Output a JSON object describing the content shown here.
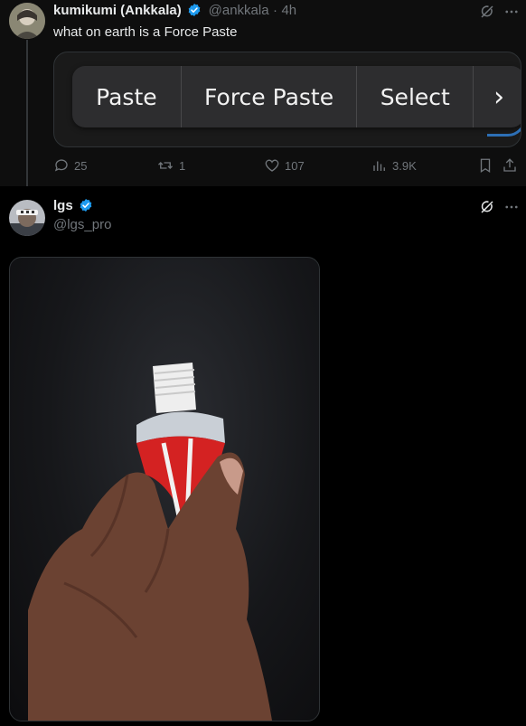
{
  "post1": {
    "author_name": "kumikumi (Ankkala)",
    "handle": "@ankkala",
    "separator": "·",
    "time": "4h",
    "text": "what on earth is a Force Paste",
    "menu": {
      "items": [
        "Paste",
        "Force Paste",
        "Select"
      ],
      "next": "›"
    },
    "actions": {
      "replies": "25",
      "reposts": "1",
      "likes": "107",
      "views": "3.9K"
    }
  },
  "post2": {
    "author_name": "lgs",
    "handle": "@lgs_pro"
  },
  "colors": {
    "verified": "#1d9bf0",
    "muted": "#71767b",
    "background": "#000000"
  }
}
